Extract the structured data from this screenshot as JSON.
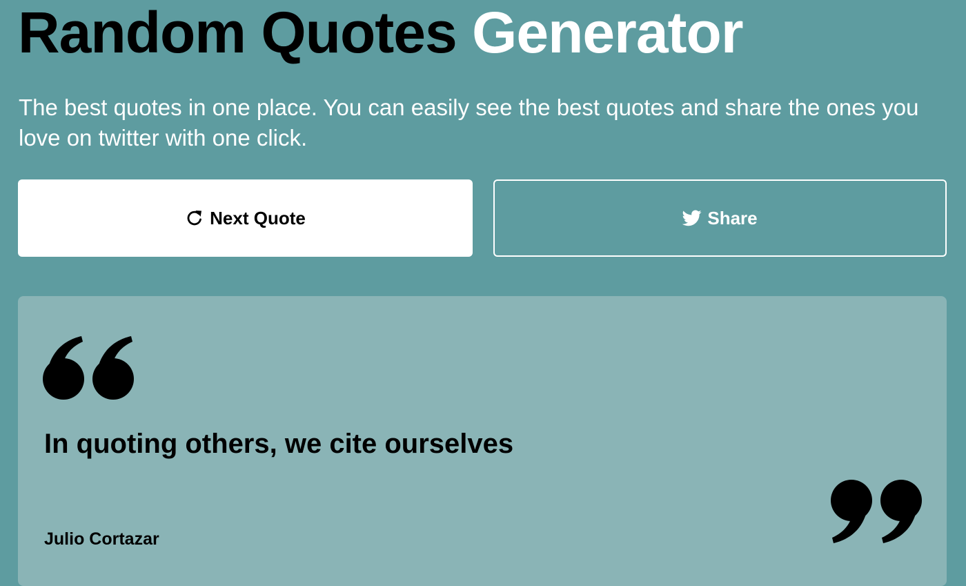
{
  "header": {
    "title_main": "Random Quotes",
    "title_accent": "Generator",
    "subtitle": "The best quotes in one place. You can easily see the best quotes and share the ones you love on twitter with one click."
  },
  "actions": {
    "next_label": "Next Quote",
    "next_icon": "refresh-icon",
    "share_label": "Share",
    "share_icon": "twitter-icon"
  },
  "quote": {
    "text": "In quoting others, we cite ourselves",
    "author": "Julio Cortazar",
    "open_icon": "quote-open-icon",
    "close_icon": "quote-close-icon"
  },
  "colors": {
    "background": "#5e9ca0",
    "card": "#8ab4b6",
    "accent": "#ffffff",
    "text": "#000000"
  }
}
